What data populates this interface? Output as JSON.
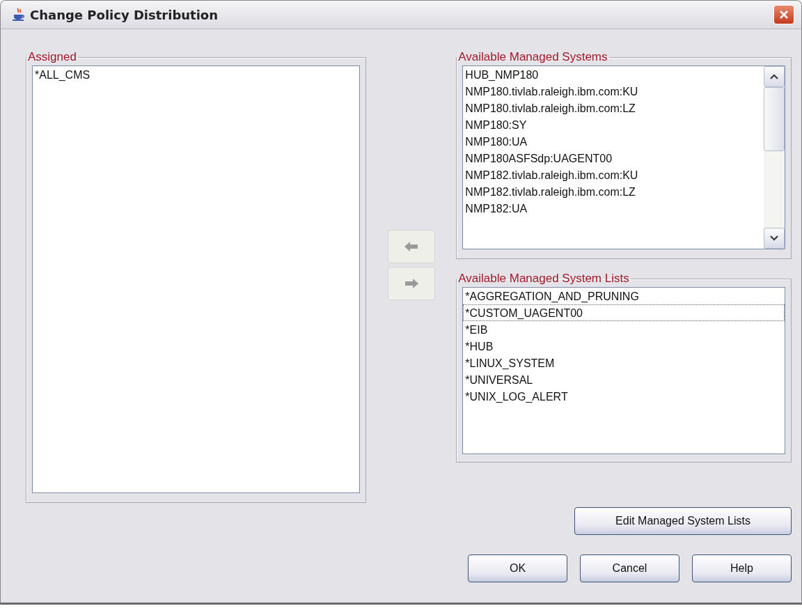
{
  "window": {
    "title": "Change Policy Distribution"
  },
  "assigned": {
    "title": "Assigned",
    "items": [
      {
        "label": "*ALL_CMS",
        "focused": false
      }
    ]
  },
  "available_systems": {
    "title": "Available Managed Systems",
    "items": [
      {
        "label": "HUB_NMP180",
        "focused": false
      },
      {
        "label": "NMP180.tivlab.raleigh.ibm.com:KU",
        "focused": false
      },
      {
        "label": "NMP180.tivlab.raleigh.ibm.com:LZ",
        "focused": false
      },
      {
        "label": "NMP180:SY",
        "focused": false
      },
      {
        "label": "NMP180:UA",
        "focused": false
      },
      {
        "label": "NMP180ASFSdp:UAGENT00",
        "focused": false
      },
      {
        "label": "NMP182.tivlab.raleigh.ibm.com:KU",
        "focused": false
      },
      {
        "label": "NMP182.tivlab.raleigh.ibm.com:LZ",
        "focused": false
      },
      {
        "label": "NMP182:UA",
        "focused": false
      }
    ]
  },
  "move_buttons": [
    {
      "kind": "left",
      "disabled": true
    },
    {
      "kind": "right",
      "disabled": true
    }
  ],
  "available_lists": {
    "title": "Available Managed System Lists",
    "items": [
      {
        "label": "*AGGREGATION_AND_PRUNING",
        "focused": false
      },
      {
        "label": "*CUSTOM_UAGENT00",
        "focused": true
      },
      {
        "label": "*EIB",
        "focused": false
      },
      {
        "label": "*HUB",
        "focused": false
      },
      {
        "label": "*LINUX_SYSTEM",
        "focused": false
      },
      {
        "label": "*UNIVERSAL",
        "focused": false
      },
      {
        "label": "*UNIX_LOG_ALERT",
        "focused": false
      }
    ]
  },
  "edit_button": {
    "label": "Edit Managed System Lists"
  },
  "buttons": [
    {
      "label": "OK"
    },
    {
      "label": "Cancel"
    },
    {
      "label": "Help"
    }
  ]
}
